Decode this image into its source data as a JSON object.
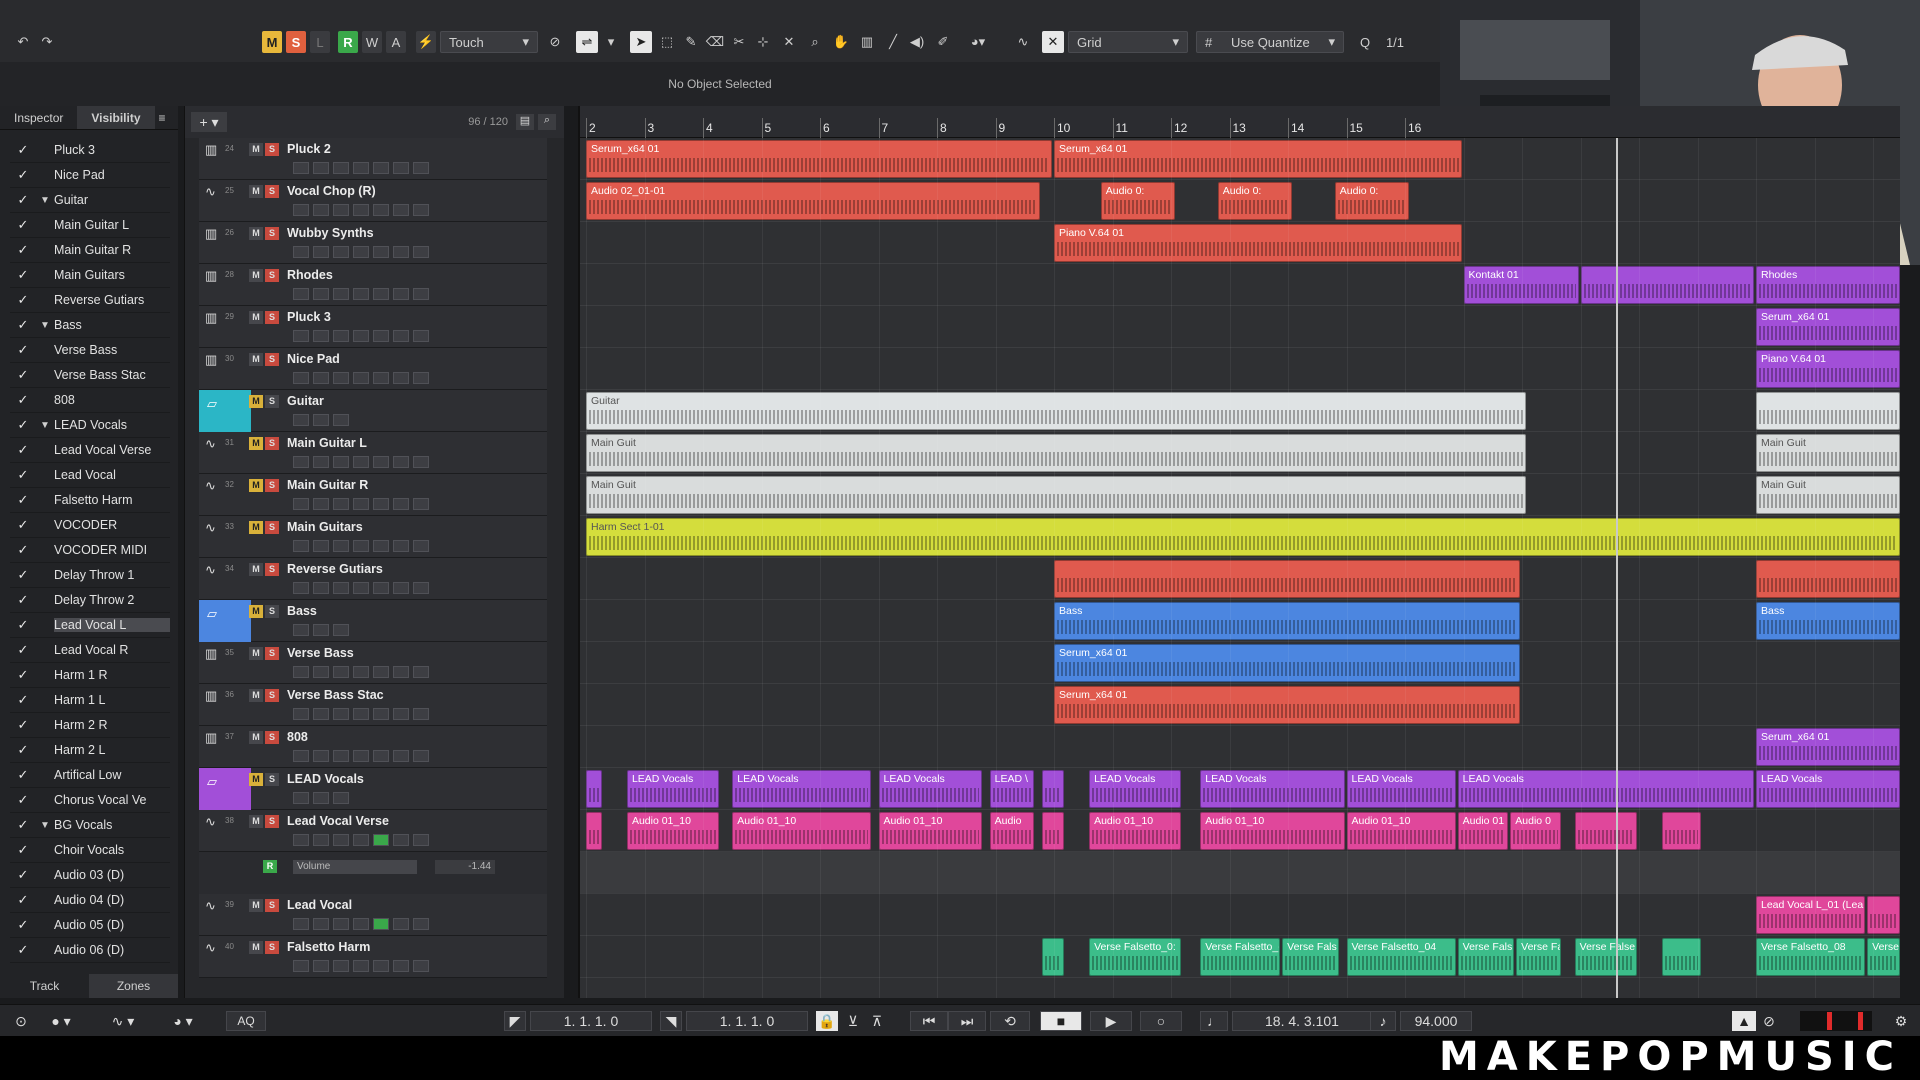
{
  "toolbar": {
    "btn_m": "M",
    "btn_s": "S",
    "btn_l": "L",
    "btn_r": "R",
    "btn_w": "W",
    "btn_a": "A",
    "auto_mode": "Touch",
    "snap_type": "Grid",
    "quantize": "Use Quantize",
    "quantize_value": "1/1",
    "status": "No Object Selected"
  },
  "left_panel": {
    "tabs": [
      "Inspector",
      "Visibility"
    ],
    "bottom_tabs": [
      "Track",
      "Zones"
    ],
    "items": [
      {
        "name": "Pluck 3",
        "tri": ""
      },
      {
        "name": "Nice Pad",
        "tri": ""
      },
      {
        "name": "Guitar",
        "tri": "▼"
      },
      {
        "name": "Main Guitar L",
        "tri": ""
      },
      {
        "name": "Main Guitar R",
        "tri": ""
      },
      {
        "name": "Main Guitars",
        "tri": ""
      },
      {
        "name": "Reverse Gutiars",
        "tri": ""
      },
      {
        "name": "Bass",
        "tri": "▼"
      },
      {
        "name": "Verse Bass",
        "tri": ""
      },
      {
        "name": "Verse Bass Stac",
        "tri": ""
      },
      {
        "name": "808",
        "tri": ""
      },
      {
        "name": "LEAD Vocals",
        "tri": "▼"
      },
      {
        "name": "Lead Vocal Verse",
        "tri": ""
      },
      {
        "name": "Lead Vocal",
        "tri": ""
      },
      {
        "name": "Falsetto Harm",
        "tri": ""
      },
      {
        "name": "VOCODER",
        "tri": ""
      },
      {
        "name": "VOCODER MIDI",
        "tri": ""
      },
      {
        "name": "Delay Throw 1",
        "tri": ""
      },
      {
        "name": "Delay Throw 2",
        "tri": ""
      },
      {
        "name": "Lead Vocal L",
        "tri": ""
      },
      {
        "name": "Lead Vocal R",
        "tri": ""
      },
      {
        "name": "Harm 1 R",
        "tri": ""
      },
      {
        "name": "Harm 1 L",
        "tri": ""
      },
      {
        "name": "Harm 2 R",
        "tri": ""
      },
      {
        "name": "Harm 2 L",
        "tri": ""
      },
      {
        "name": "Artifical Low",
        "tri": ""
      },
      {
        "name": "Chorus Vocal Ve",
        "tri": ""
      },
      {
        "name": "BG Vocals",
        "tri": "▼"
      },
      {
        "name": "Choir Vocals",
        "tri": ""
      },
      {
        "name": "Audio 03 (D)",
        "tri": ""
      },
      {
        "name": "Audio 04 (D)",
        "tri": ""
      },
      {
        "name": "Audio 05 (D)",
        "tri": ""
      },
      {
        "name": "Audio 06 (D)",
        "tri": ""
      }
    ],
    "check": "✓"
  },
  "tracklist": {
    "count": "96 / 120",
    "add": "+ ▾",
    "tracks": [
      {
        "num": "24",
        "name": "Pluck 2",
        "type": "inst"
      },
      {
        "num": "25",
        "name": "Vocal  Chop (R)",
        "type": "audio"
      },
      {
        "num": "26",
        "name": "Wubby Synths",
        "type": "inst"
      },
      {
        "num": "28",
        "name": "Rhodes",
        "type": "inst"
      },
      {
        "num": "29",
        "name": "Pluck 3",
        "type": "inst"
      },
      {
        "num": "30",
        "name": "Nice Pad",
        "type": "inst"
      },
      {
        "num": "",
        "name": "Guitar",
        "type": "folder",
        "color": "#2bb6c6"
      },
      {
        "num": "31",
        "name": "Main Guitar L",
        "type": "audio"
      },
      {
        "num": "32",
        "name": "Main Guitar R",
        "type": "audio"
      },
      {
        "num": "33",
        "name": "Main Guitars",
        "type": "audio"
      },
      {
        "num": "34",
        "name": "Reverse Gutiars",
        "type": "audio"
      },
      {
        "num": "",
        "name": "Bass",
        "type": "folder",
        "color": "#4c86e0"
      },
      {
        "num": "35",
        "name": "Verse Bass",
        "type": "inst"
      },
      {
        "num": "36",
        "name": "Verse Bass Stac",
        "type": "inst"
      },
      {
        "num": "37",
        "name": "808",
        "type": "inst"
      },
      {
        "num": "",
        "name": "LEAD Vocals",
        "type": "folder",
        "color": "#a24fd8"
      },
      {
        "num": "38",
        "name": "Lead Vocal Verse",
        "type": "audio"
      },
      {
        "num": "",
        "name": "Volume",
        "type": "automation",
        "value": "-1.44"
      },
      {
        "num": "39",
        "name": "Lead Vocal",
        "type": "audio"
      },
      {
        "num": "40",
        "name": "Falsetto Harm",
        "type": "audio"
      }
    ]
  },
  "ruler": {
    "bars": [
      "2",
      "3",
      "4",
      "5",
      "6",
      "7",
      "8",
      "9",
      "10",
      "11",
      "12",
      "13",
      "14",
      "15",
      "16"
    ]
  },
  "clips": [
    {
      "lane": 0,
      "bar_start": 2,
      "bar_end": 10,
      "label": "Serum_x64 01",
      "color": "#e05a4e"
    },
    {
      "lane": 0,
      "bar_start": 10,
      "bar_end": 17,
      "label": "Serum_x64 01",
      "color": "#e05a4e"
    },
    {
      "lane": 1,
      "bar_start": 2,
      "bar_end": 9.8,
      "label": "Audio 02_01-01",
      "color": "#e05a4e"
    },
    {
      "lane": 1,
      "bar_start": 10.8,
      "bar_end": 12.1,
      "label": "Audio 0:",
      "color": "#e05a4e"
    },
    {
      "lane": 1,
      "bar_start": 12.8,
      "bar_end": 14.1,
      "label": "Audio 0:",
      "color": "#e05a4e"
    },
    {
      "lane": 1,
      "bar_start": 14.8,
      "bar_end": 16.1,
      "label": "Audio 0:",
      "color": "#e05a4e"
    },
    {
      "lane": 2,
      "bar_start": 10,
      "bar_end": 17,
      "label": "Piano V.64 01",
      "color": "#e05a4e"
    },
    {
      "lane": 3,
      "bar_start": 17,
      "bar_end": 19,
      "label": "Kontakt 01",
      "color": "#a24fd8"
    },
    {
      "lane": 3,
      "bar_start": 19,
      "bar_end": 22,
      "label": "",
      "color": "#a24fd8"
    },
    {
      "lane": 3,
      "bar_start": 22,
      "bar_end": 24.9,
      "label": "Rhodes",
      "color": "#a24fd8"
    },
    {
      "lane": 4,
      "bar_start": 22,
      "bar_end": 24.9,
      "label": "Serum_x64 01",
      "color": "#a24fd8"
    },
    {
      "lane": 5,
      "bar_start": 22,
      "bar_end": 24.9,
      "label": "Piano V.64 01",
      "color": "#a24fd8"
    },
    {
      "lane": 6,
      "bar_start": 2,
      "bar_end": 18.1,
      "label": "Guitar",
      "color": "#dfe3e4"
    },
    {
      "lane": 6,
      "bar_start": 22,
      "bar_end": 24.9,
      "label": "",
      "color": "#dfe3e4"
    },
    {
      "lane": 7,
      "bar_start": 2,
      "bar_end": 18.1,
      "label": "Main Guit",
      "color": "#d9dcdc"
    },
    {
      "lane": 7,
      "bar_start": 22,
      "bar_end": 24.9,
      "label": "Main Guit",
      "color": "#d9dcdc"
    },
    {
      "lane": 8,
      "bar_start": 2,
      "bar_end": 18.1,
      "label": "Main Guit",
      "color": "#d9dcdc"
    },
    {
      "lane": 8,
      "bar_start": 22,
      "bar_end": 24.9,
      "label": "Main Guit",
      "color": "#d9dcdc"
    },
    {
      "lane": 9,
      "bar_start": 2,
      "bar_end": 24.9,
      "label": "Harm Sect 1-01",
      "color": "#d4dd3c"
    },
    {
      "lane": 10,
      "bar_start": 10,
      "bar_end": 18,
      "label": "",
      "color": "#e05a4e"
    },
    {
      "lane": 10,
      "bar_start": 22,
      "bar_end": 24.9,
      "label": "",
      "color": "#e05a4e"
    },
    {
      "lane": 11,
      "bar_start": 10,
      "bar_end": 18,
      "label": "Bass",
      "color": "#4c86e0"
    },
    {
      "lane": 11,
      "bar_start": 22,
      "bar_end": 24.9,
      "label": "Bass",
      "color": "#4c86e0"
    },
    {
      "lane": 12,
      "bar_start": 10,
      "bar_end": 18,
      "label": "Serum_x64 01",
      "color": "#4c86e0"
    },
    {
      "lane": 13,
      "bar_start": 10,
      "bar_end": 18,
      "label": "Serum_x64 01",
      "color": "#e05a4e"
    },
    {
      "lane": 14,
      "bar_start": 22,
      "bar_end": 24.9,
      "label": "Serum_x64 01",
      "color": "#a24fd8"
    },
    {
      "lane": 15,
      "bar_start": 2,
      "bar_end": 2.3,
      "label": "",
      "color": "#a24fd8"
    },
    {
      "lane": 15,
      "bar_start": 2.7,
      "bar_end": 4.3,
      "label": "LEAD Vocals",
      "color": "#a24fd8"
    },
    {
      "lane": 15,
      "bar_start": 4.5,
      "bar_end": 6.9,
      "label": "LEAD Vocals",
      "color": "#a24fd8"
    },
    {
      "lane": 15,
      "bar_start": 7.0,
      "bar_end": 8.8,
      "label": "LEAD Vocals",
      "color": "#a24fd8"
    },
    {
      "lane": 15,
      "bar_start": 8.9,
      "bar_end": 9.7,
      "label": "LEAD \\",
      "color": "#a24fd8"
    },
    {
      "lane": 15,
      "bar_start": 9.8,
      "bar_end": 10.2,
      "label": "",
      "color": "#a24fd8"
    },
    {
      "lane": 15,
      "bar_start": 10.6,
      "bar_end": 12.2,
      "label": "LEAD Vocals",
      "color": "#a24fd8"
    },
    {
      "lane": 15,
      "bar_start": 12.5,
      "bar_end": 15.0,
      "label": "LEAD Vocals",
      "color": "#a24fd8"
    },
    {
      "lane": 15,
      "bar_start": 15.0,
      "bar_end": 16.9,
      "label": "LEAD Vocals",
      "color": "#a24fd8"
    },
    {
      "lane": 15,
      "bar_start": 16.9,
      "bar_end": 22,
      "label": "LEAD Vocals",
      "color": "#a24fd8"
    },
    {
      "lane": 15,
      "bar_start": 22,
      "bar_end": 24.9,
      "label": "LEAD Vocals",
      "color": "#a24fd8"
    },
    {
      "lane": 16,
      "bar_start": 2,
      "bar_end": 2.3,
      "label": "",
      "color": "#e0479b"
    },
    {
      "lane": 16,
      "bar_start": 2.7,
      "bar_end": 4.3,
      "label": "Audio 01_10",
      "color": "#e0479b"
    },
    {
      "lane": 16,
      "bar_start": 4.5,
      "bar_end": 6.9,
      "label": "Audio 01_10",
      "color": "#e0479b"
    },
    {
      "lane": 16,
      "bar_start": 7.0,
      "bar_end": 8.8,
      "label": "Audio 01_10",
      "color": "#e0479b"
    },
    {
      "lane": 16,
      "bar_start": 8.9,
      "bar_end": 9.7,
      "label": "Audio",
      "color": "#e0479b"
    },
    {
      "lane": 16,
      "bar_start": 9.8,
      "bar_end": 10.2,
      "label": "",
      "color": "#e0479b"
    },
    {
      "lane": 16,
      "bar_start": 10.6,
      "bar_end": 12.2,
      "label": "Audio 01_10",
      "color": "#e0479b"
    },
    {
      "lane": 16,
      "bar_start": 12.5,
      "bar_end": 15.0,
      "label": "Audio 01_10",
      "color": "#e0479b"
    },
    {
      "lane": 16,
      "bar_start": 15.0,
      "bar_end": 16.9,
      "label": "Audio 01_10",
      "color": "#e0479b"
    },
    {
      "lane": 16,
      "bar_start": 16.9,
      "bar_end": 17.8,
      "label": "Audio 01",
      "color": "#e0479b"
    },
    {
      "lane": 16,
      "bar_start": 17.8,
      "bar_end": 18.7,
      "label": "Audio 0",
      "color": "#e0479b"
    },
    {
      "lane": 16,
      "bar_start": 18.9,
      "bar_end": 20.0,
      "label": "",
      "color": "#e0479b"
    },
    {
      "lane": 16,
      "bar_start": 20.4,
      "bar_end": 21.1,
      "label": "",
      "color": "#e0479b"
    },
    {
      "lane": 18,
      "bar_start": 22,
      "bar_end": 23.9,
      "label": "Lead Vocal L_01 (Lea",
      "color": "#e0479b"
    },
    {
      "lane": 18,
      "bar_start": 23.9,
      "bar_end": 24.9,
      "label": "",
      "color": "#e0479b"
    },
    {
      "lane": 19,
      "bar_start": 9.8,
      "bar_end": 10.2,
      "label": "",
      "color": "#3cbd8a"
    },
    {
      "lane": 19,
      "bar_start": 10.6,
      "bar_end": 12.2,
      "label": "Verse Falsetto_0:",
      "color": "#3cbd8a"
    },
    {
      "lane": 19,
      "bar_start": 12.5,
      "bar_end": 13.9,
      "label": "Verse Falsetto_(",
      "color": "#3cbd8a"
    },
    {
      "lane": 19,
      "bar_start": 13.9,
      "bar_end": 14.9,
      "label": "Verse Fals",
      "color": "#3cbd8a"
    },
    {
      "lane": 19,
      "bar_start": 15.0,
      "bar_end": 16.9,
      "label": "Verse Falsetto_04",
      "color": "#3cbd8a"
    },
    {
      "lane": 19,
      "bar_start": 16.9,
      "bar_end": 17.9,
      "label": "Verse Fals",
      "color": "#3cbd8a"
    },
    {
      "lane": 19,
      "bar_start": 17.9,
      "bar_end": 18.7,
      "label": "Verse Fa",
      "color": "#3cbd8a"
    },
    {
      "lane": 19,
      "bar_start": 18.9,
      "bar_end": 20.0,
      "label": "Verse False",
      "color": "#3cbd8a"
    },
    {
      "lane": 19,
      "bar_start": 20.4,
      "bar_end": 21.1,
      "label": "",
      "color": "#3cbd8a"
    },
    {
      "lane": 19,
      "bar_start": 22,
      "bar_end": 23.9,
      "label": "Verse Falsetto_08",
      "color": "#3cbd8a"
    },
    {
      "lane": 19,
      "bar_start": 23.9,
      "bar_end": 24.9,
      "label": "Verse False",
      "color": "#3cbd8a"
    }
  ],
  "transport": {
    "left_locator": "1. 1. 1.   0",
    "right_locator": "1. 1. 1.   0",
    "position": "18. 4. 3.101",
    "tempo": "94.000",
    "aq": "AQ"
  },
  "brand": "MAKEPOPMUSIC",
  "colors": {
    "accent_red": "#e05a4e",
    "accent_purple": "#a24fd8",
    "accent_blue": "#4c86e0",
    "accent_teal": "#2bb6c6",
    "accent_pink": "#e0479b",
    "accent_green": "#3cbd8a",
    "accent_yellow": "#d4dd3c"
  }
}
